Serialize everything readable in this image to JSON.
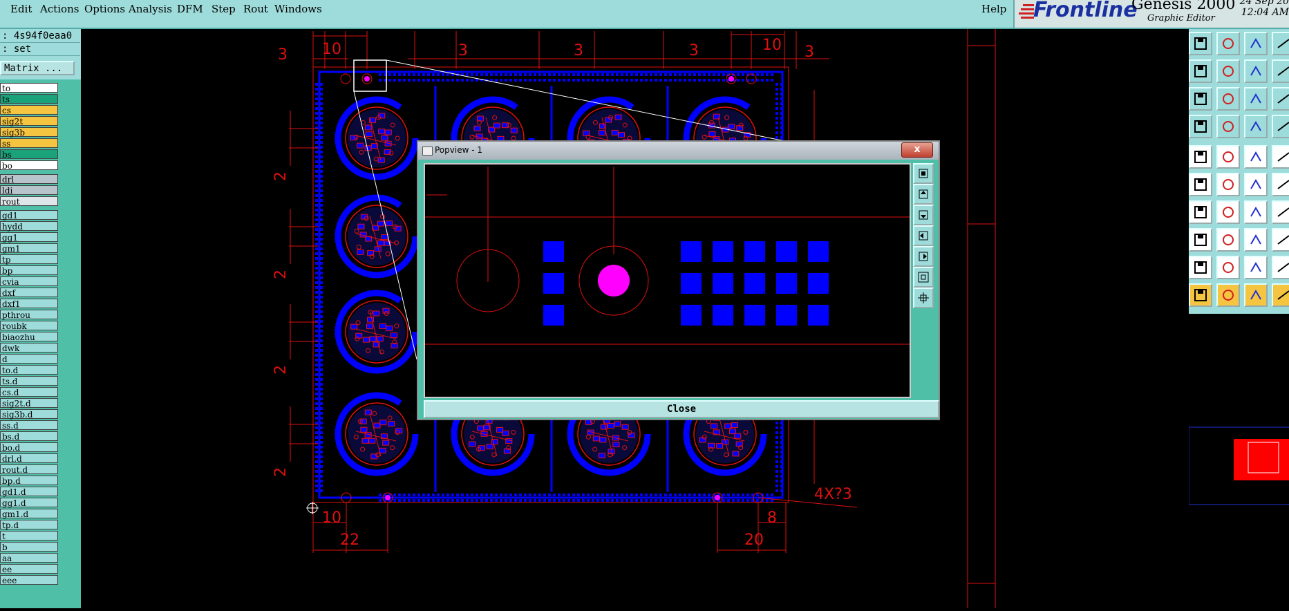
{
  "menu": {
    "items": [
      "Edit",
      "Actions",
      "Options",
      "Analysis",
      "DFM",
      "Step",
      "Rout",
      "Windows"
    ],
    "help": "Help"
  },
  "header": {
    "brand": "Frontline",
    "product": "Genesis 2000",
    "subtitle": "Graphic Editor",
    "date": "24 Sep 20",
    "time": "12:04 AM"
  },
  "left_panel": {
    "job_line": ": 4s94f0eaa0",
    "step_line": ": set",
    "matrix_label": "Matrix ...",
    "layers": [
      {
        "name": "to",
        "color": "#ffffff"
      },
      {
        "name": "ts",
        "color": "#1aa37a"
      },
      {
        "name": "cs",
        "color": "#f5c542"
      },
      {
        "name": "sig2t",
        "color": "#f5c542"
      },
      {
        "name": "sig3b",
        "color": "#f5c542"
      },
      {
        "name": "ss",
        "color": "#f5c542"
      },
      {
        "name": "bs",
        "color": "#1aa37a"
      },
      {
        "name": "bo",
        "color": "#ffffff"
      },
      {
        "name": "drl",
        "color": "#b8c4cc"
      },
      {
        "name": "ldi",
        "color": "#b8c4cc"
      },
      {
        "name": "rout",
        "color": "#dfe6ea"
      },
      {
        "name": "gd1",
        "color": "#9ddcda"
      },
      {
        "name": "hydd",
        "color": "#9ddcda"
      },
      {
        "name": "gg1",
        "color": "#9ddcda"
      },
      {
        "name": "gm1",
        "color": "#9ddcda"
      },
      {
        "name": "tp",
        "color": "#9ddcda"
      },
      {
        "name": "bp",
        "color": "#9ddcda"
      },
      {
        "name": "cvia",
        "color": "#9ddcda"
      },
      {
        "name": "dxf",
        "color": "#9ddcda"
      },
      {
        "name": "dxf1",
        "color": "#9ddcda"
      },
      {
        "name": "pthrou",
        "color": "#9ddcda"
      },
      {
        "name": "roubk",
        "color": "#9ddcda"
      },
      {
        "name": "biaozhu",
        "color": "#9ddcda"
      },
      {
        "name": "dwk",
        "color": "#9ddcda"
      },
      {
        "name": "d",
        "color": "#9ddcda"
      },
      {
        "name": "to.d",
        "color": "#9ddcda"
      },
      {
        "name": "ts.d",
        "color": "#9ddcda"
      },
      {
        "name": "cs.d",
        "color": "#9ddcda"
      },
      {
        "name": "sig2t.d",
        "color": "#9ddcda"
      },
      {
        "name": "sig3b.d",
        "color": "#9ddcda"
      },
      {
        "name": "ss.d",
        "color": "#9ddcda"
      },
      {
        "name": "bs.d",
        "color": "#9ddcda"
      },
      {
        "name": "bo.d",
        "color": "#9ddcda"
      },
      {
        "name": "drl.d",
        "color": "#9ddcda"
      },
      {
        "name": "rout.d",
        "color": "#9ddcda"
      },
      {
        "name": "bp.d",
        "color": "#9ddcda"
      },
      {
        "name": "gd1.d",
        "color": "#9ddcda"
      },
      {
        "name": "gg1.d",
        "color": "#9ddcda"
      },
      {
        "name": "gm1.d",
        "color": "#9ddcda"
      },
      {
        "name": "tp.d",
        "color": "#9ddcda"
      },
      {
        "name": "t",
        "color": "#9ddcda"
      },
      {
        "name": "b",
        "color": "#9ddcda"
      },
      {
        "name": "aa",
        "color": "#9ddcda"
      },
      {
        "name": "ee",
        "color": "#9ddcda"
      },
      {
        "name": "eee",
        "color": "#9ddcda"
      }
    ]
  },
  "canvas": {
    "dimensions": {
      "top": [
        "10",
        "10",
        "3",
        "3",
        "3",
        "10",
        "3",
        "3"
      ],
      "left": [
        "2",
        "2",
        "2",
        "2"
      ],
      "bottom": [
        "10",
        "22",
        "20",
        "8"
      ],
      "hole_note": "4X?3"
    }
  },
  "popup": {
    "title": "Popview - 1",
    "close_x": "x",
    "close_label": "Close"
  },
  "colors": {
    "ui_teal": "#9ddcda",
    "ui_green": "#4fbfa8",
    "copper_blue": "#0000ff",
    "outline_red": "#e01010",
    "pad_magenta": "#ff00ff"
  }
}
